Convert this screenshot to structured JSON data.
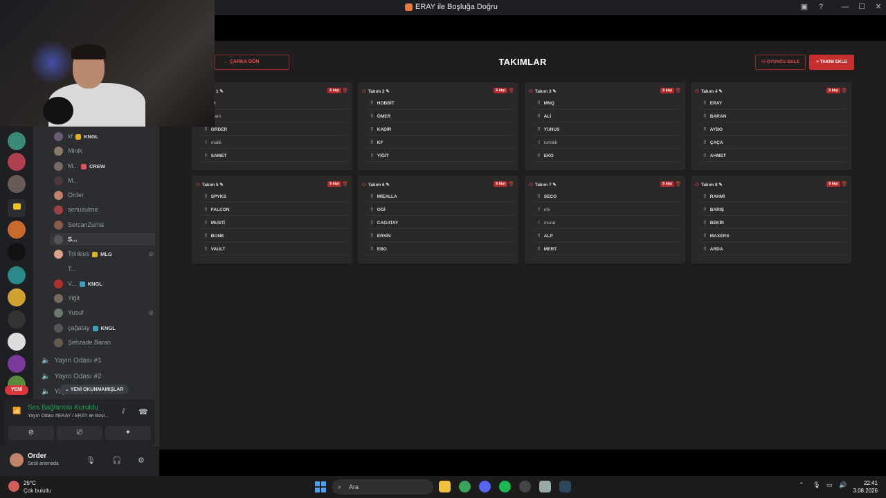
{
  "window": {
    "title": "ERAY ile Boşluğa Doğru"
  },
  "header": {
    "back_label": "ÇARKA DÖN",
    "title": "TAKIMLAR",
    "add_player_label": "OYUNCU EKLE",
    "add_team_label": "TAKIM EKLE"
  },
  "teams": [
    {
      "name": "Takım 1",
      "badge": "5 kişi",
      "players": [
        "ÇI",
        "...am",
        "ORDER",
        "malik",
        "SAMET"
      ]
    },
    {
      "name": "Takım 2",
      "badge": "5 kişi",
      "players": [
        "HOBBİT",
        "ÖMER",
        "KADİR",
        "KF",
        "YİĞİT"
      ]
    },
    {
      "name": "Takım 3",
      "badge": "5 kişi",
      "players": [
        "MNQ",
        "ALİ",
        "YUNUS",
        "tombik",
        "EKO"
      ]
    },
    {
      "name": "Takım 4",
      "badge": "5 kişi",
      "players": [
        "ERAY",
        "BARAN",
        "AYBO",
        "ÇAÇA",
        "AHMET"
      ]
    },
    {
      "name": "Takım 5",
      "badge": "5 kişi",
      "players": [
        "SPYKS",
        "FALCON",
        "MUSTİ",
        "BONE",
        "VAULT"
      ]
    },
    {
      "name": "Takım 6",
      "badge": "5 kişi",
      "players": [
        "MİEALLA",
        "OGİ",
        "CAGATAY",
        "ERSİN",
        "EBO"
      ]
    },
    {
      "name": "Takım 7",
      "badge": "5 kişi",
      "players": [
        "SECO",
        "efe",
        "murat",
        "ALP",
        "MERT"
      ]
    },
    {
      "name": "Takım 8",
      "badge": "5 kişi",
      "players": [
        "RAHMİ",
        "BARIŞ",
        "BEKİR",
        "MAXERS",
        "ARDA"
      ]
    }
  ],
  "discord": {
    "members": [
      {
        "name": "kf",
        "tag": "KNGL",
        "color": "#6b5b73"
      },
      {
        "name": "Minik",
        "tag": "",
        "color": "#8a7a6a"
      },
      {
        "name": "M...",
        "tag": "CREW",
        "color": "#7a6a66"
      },
      {
        "name": "M...",
        "tag": "",
        "color": "#4a3a3a"
      },
      {
        "name": "Order",
        "tag": "",
        "color": "#c0836a"
      },
      {
        "name": "senuzulme",
        "tag": "",
        "color": "#a04040"
      },
      {
        "name": "SercanZurna",
        "tag": "",
        "color": "#8a5a4a"
      },
      {
        "name": "S...",
        "tag": "",
        "color": "#555"
      },
      {
        "name": "Trinkies",
        "tag": "MLG",
        "color": "#d9a58a"
      },
      {
        "name": "T...",
        "tag": "",
        "color": "#2b2d31"
      },
      {
        "name": "V...",
        "tag": "KNGL",
        "color": "#b03030"
      },
      {
        "name": "Yiğit",
        "tag": "",
        "color": "#7a6a5a"
      },
      {
        "name": "Yusuf",
        "tag": "",
        "color": "#6a7a6a"
      },
      {
        "name": "çağatay",
        "tag": "KNGL",
        "color": "#555"
      },
      {
        "name": "Şehzade Baran",
        "tag": "",
        "color": "#6a5a4a"
      }
    ],
    "voice_channels": [
      "Yayın Odası #1",
      "Yayın Odası #2",
      "Yay..."
    ],
    "unread_label": "YENİ OKUNMAMIŞLAR",
    "new_label": "YENİ",
    "voice_status": "Ses Bağlantısı Kuruldu",
    "voice_sub": "Yayın Odası #ERAY / ERAY ile Boşl...",
    "user_name": "Order",
    "user_status": "Sesli aramada"
  },
  "taskbar": {
    "temp": "25°C",
    "condition": "Çok bulutlu",
    "search_placeholder": "Ara",
    "time": "22:41",
    "date": "3.08.2026"
  }
}
